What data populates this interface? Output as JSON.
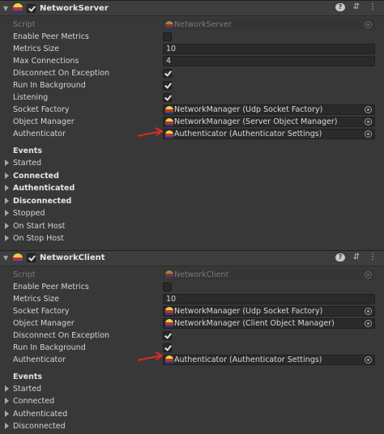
{
  "server": {
    "title": "NetworkServer",
    "script_label": "Script",
    "script_value": "NetworkServer",
    "enable_peer_metrics_label": "Enable Peer Metrics",
    "metrics_size_label": "Metrics Size",
    "metrics_size_value": "10",
    "max_connections_label": "Max Connections",
    "max_connections_value": "4",
    "disconnect_on_exception_label": "Disconnect On Exception",
    "run_in_background_label": "Run In Background",
    "listening_label": "Listening",
    "socket_factory_label": "Socket Factory",
    "socket_factory_value": "NetworkManager (Udp Socket Factory)",
    "object_manager_label": "Object Manager",
    "object_manager_value": "NetworkManager (Server Object Manager)",
    "authenticator_label": "Authenticator",
    "authenticator_value": "Authenticator (Authenticator Settings)",
    "events_label": "Events",
    "events": [
      "Started",
      "Connected",
      "Authenticated",
      "Disconnected",
      "Stopped",
      "On Start Host",
      "On Stop Host"
    ]
  },
  "client": {
    "title": "NetworkClient",
    "script_label": "Script",
    "script_value": "NetworkClient",
    "enable_peer_metrics_label": "Enable Peer Metrics",
    "metrics_size_label": "Metrics Size",
    "metrics_size_value": "10",
    "socket_factory_label": "Socket Factory",
    "socket_factory_value": "NetworkManager (Udp Socket Factory)",
    "object_manager_label": "Object Manager",
    "object_manager_value": "NetworkManager (Client Object Manager)",
    "disconnect_on_exception_label": "Disconnect On Exception",
    "run_in_background_label": "Run In Background",
    "authenticator_label": "Authenticator",
    "authenticator_value": "Authenticator (Authenticator Settings)",
    "events_label": "Events",
    "events": [
      "Started",
      "Connected",
      "Authenticated",
      "Disconnected"
    ]
  },
  "header_icons": {
    "help": "?",
    "presets": "⇵",
    "menu": "⋮"
  },
  "colors": {
    "annotation_arrow": "#e02a2a"
  },
  "icons": [
    "component-icon",
    "help-icon",
    "presets-icon",
    "context-menu-icon",
    "object-picker-icon"
  ]
}
